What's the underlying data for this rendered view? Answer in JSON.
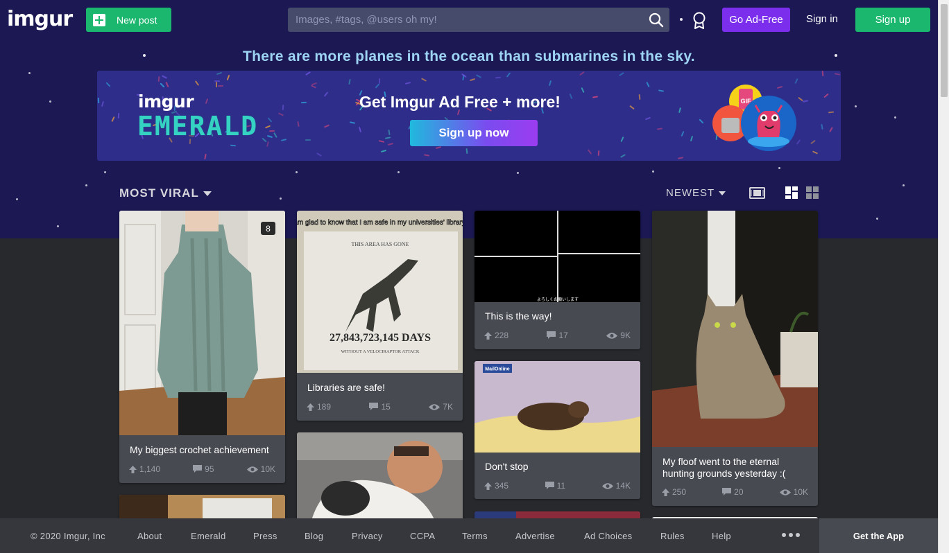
{
  "header": {
    "logo": "imgur",
    "new_post": "New post",
    "search_placeholder": "Images, #tags, @users oh my!",
    "go_ad_free": "Go Ad-Free",
    "sign_in": "Sign in",
    "sign_up": "Sign up"
  },
  "tagline": "There are more planes in the ocean than submarines in the sky.",
  "banner": {
    "logo": "imgur",
    "product": "EMERALD",
    "headline": "Get Imgur Ad Free + more!",
    "cta": "Sign up now",
    "mascot_label": "GIF"
  },
  "sort": {
    "section": "MOST VIRAL",
    "order": "NEWEST"
  },
  "posts": [
    {
      "title": "My biggest crochet achievement",
      "upvotes": "1,140",
      "comments": "95",
      "views": "10K",
      "image_count": "8"
    },
    {
      "title": "Libraries are safe!",
      "upvotes": "189",
      "comments": "15",
      "views": "7K",
      "image_caption": "I am glad to know that I am safe in my universities' library...",
      "sign_top": "THIS AREA HAS GONE",
      "sign_days": "27,843,723,145 DAYS",
      "sign_bottom": "WITHOUT A VELOCIRAPTOR ATTACK"
    },
    {
      "title": "This is the way!",
      "upvotes": "228",
      "comments": "17",
      "views": "9K",
      "subtitle": "よろしくお願いします"
    },
    {
      "title": "Don't stop",
      "upvotes": "345",
      "comments": "11",
      "views": "14K",
      "watermark": "MailOnline"
    },
    {
      "title": "My floof went to the eternal hunting grounds yesterday :(",
      "upvotes": "250",
      "comments": "20",
      "views": "10K"
    }
  ],
  "footer": {
    "copyright": "© 2020 Imgur, Inc",
    "links": [
      "About",
      "Emerald",
      "Press",
      "Blog",
      "Privacy",
      "CCPA",
      "Terms",
      "Advertise",
      "Ad Choices",
      "Rules",
      "Help"
    ],
    "get_app": "Get the App"
  },
  "colors": {
    "hero_bg": "#1b1853",
    "page_bg": "#27292d",
    "card_bg": "#474a51",
    "green": "#1bb76e",
    "purple": "#7b2fed",
    "tagline": "#9ed4f3",
    "emerald": "#35d2c3"
  }
}
